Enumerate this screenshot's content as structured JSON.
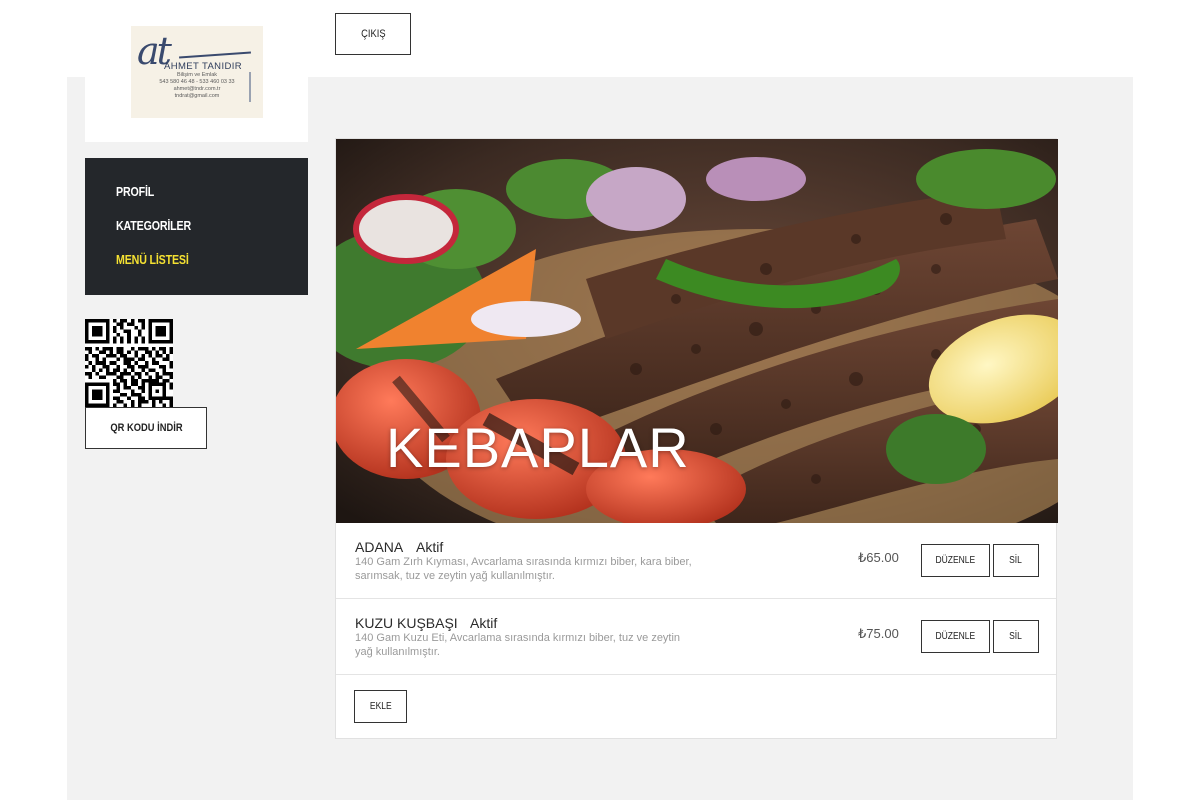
{
  "logo": {
    "script": "at",
    "name": "AHMET TANIDIR",
    "subtitle": "Bilişim ve Emlak",
    "phones": "543 580 46 48  -  533 460 03 33",
    "email1": "ahmet@tndr.com.tr",
    "email2": "tndrat@gmail.com"
  },
  "header": {
    "logout_label": "ÇIKIŞ"
  },
  "sidebar": {
    "items": [
      {
        "label": "PROFİL",
        "active": false
      },
      {
        "label": "KATEGORİLER",
        "active": false
      },
      {
        "label": "MENÜ LİSTESİ",
        "active": true
      }
    ],
    "active_color": "#f5e132",
    "background": "#24272b"
  },
  "qr": {
    "download_label": "QR KODU İNDİR"
  },
  "category": {
    "title": "KEBAPLAR",
    "items": [
      {
        "name": "ADANA",
        "status": "Aktif",
        "description": "140 Gam Zırh Kıyması, Avcarlama sırasında kırmızı biber, kara biber, sarımsak, tuz ve zeytin yağ kullanılmıştır.",
        "price": "₺65.00",
        "edit_label": "DÜZENLE",
        "delete_label": "SİL"
      },
      {
        "name": "KUZU KUŞBAŞI",
        "status": "Aktif",
        "description": "140 Gam Kuzu Eti, Avcarlama sırasında kırmızı biber, tuz ve zeytin yağ kullanılmıştır.",
        "price": "₺75.00",
        "edit_label": "DÜZENLE",
        "delete_label": "SİL"
      }
    ],
    "add_label": "EKLE"
  }
}
